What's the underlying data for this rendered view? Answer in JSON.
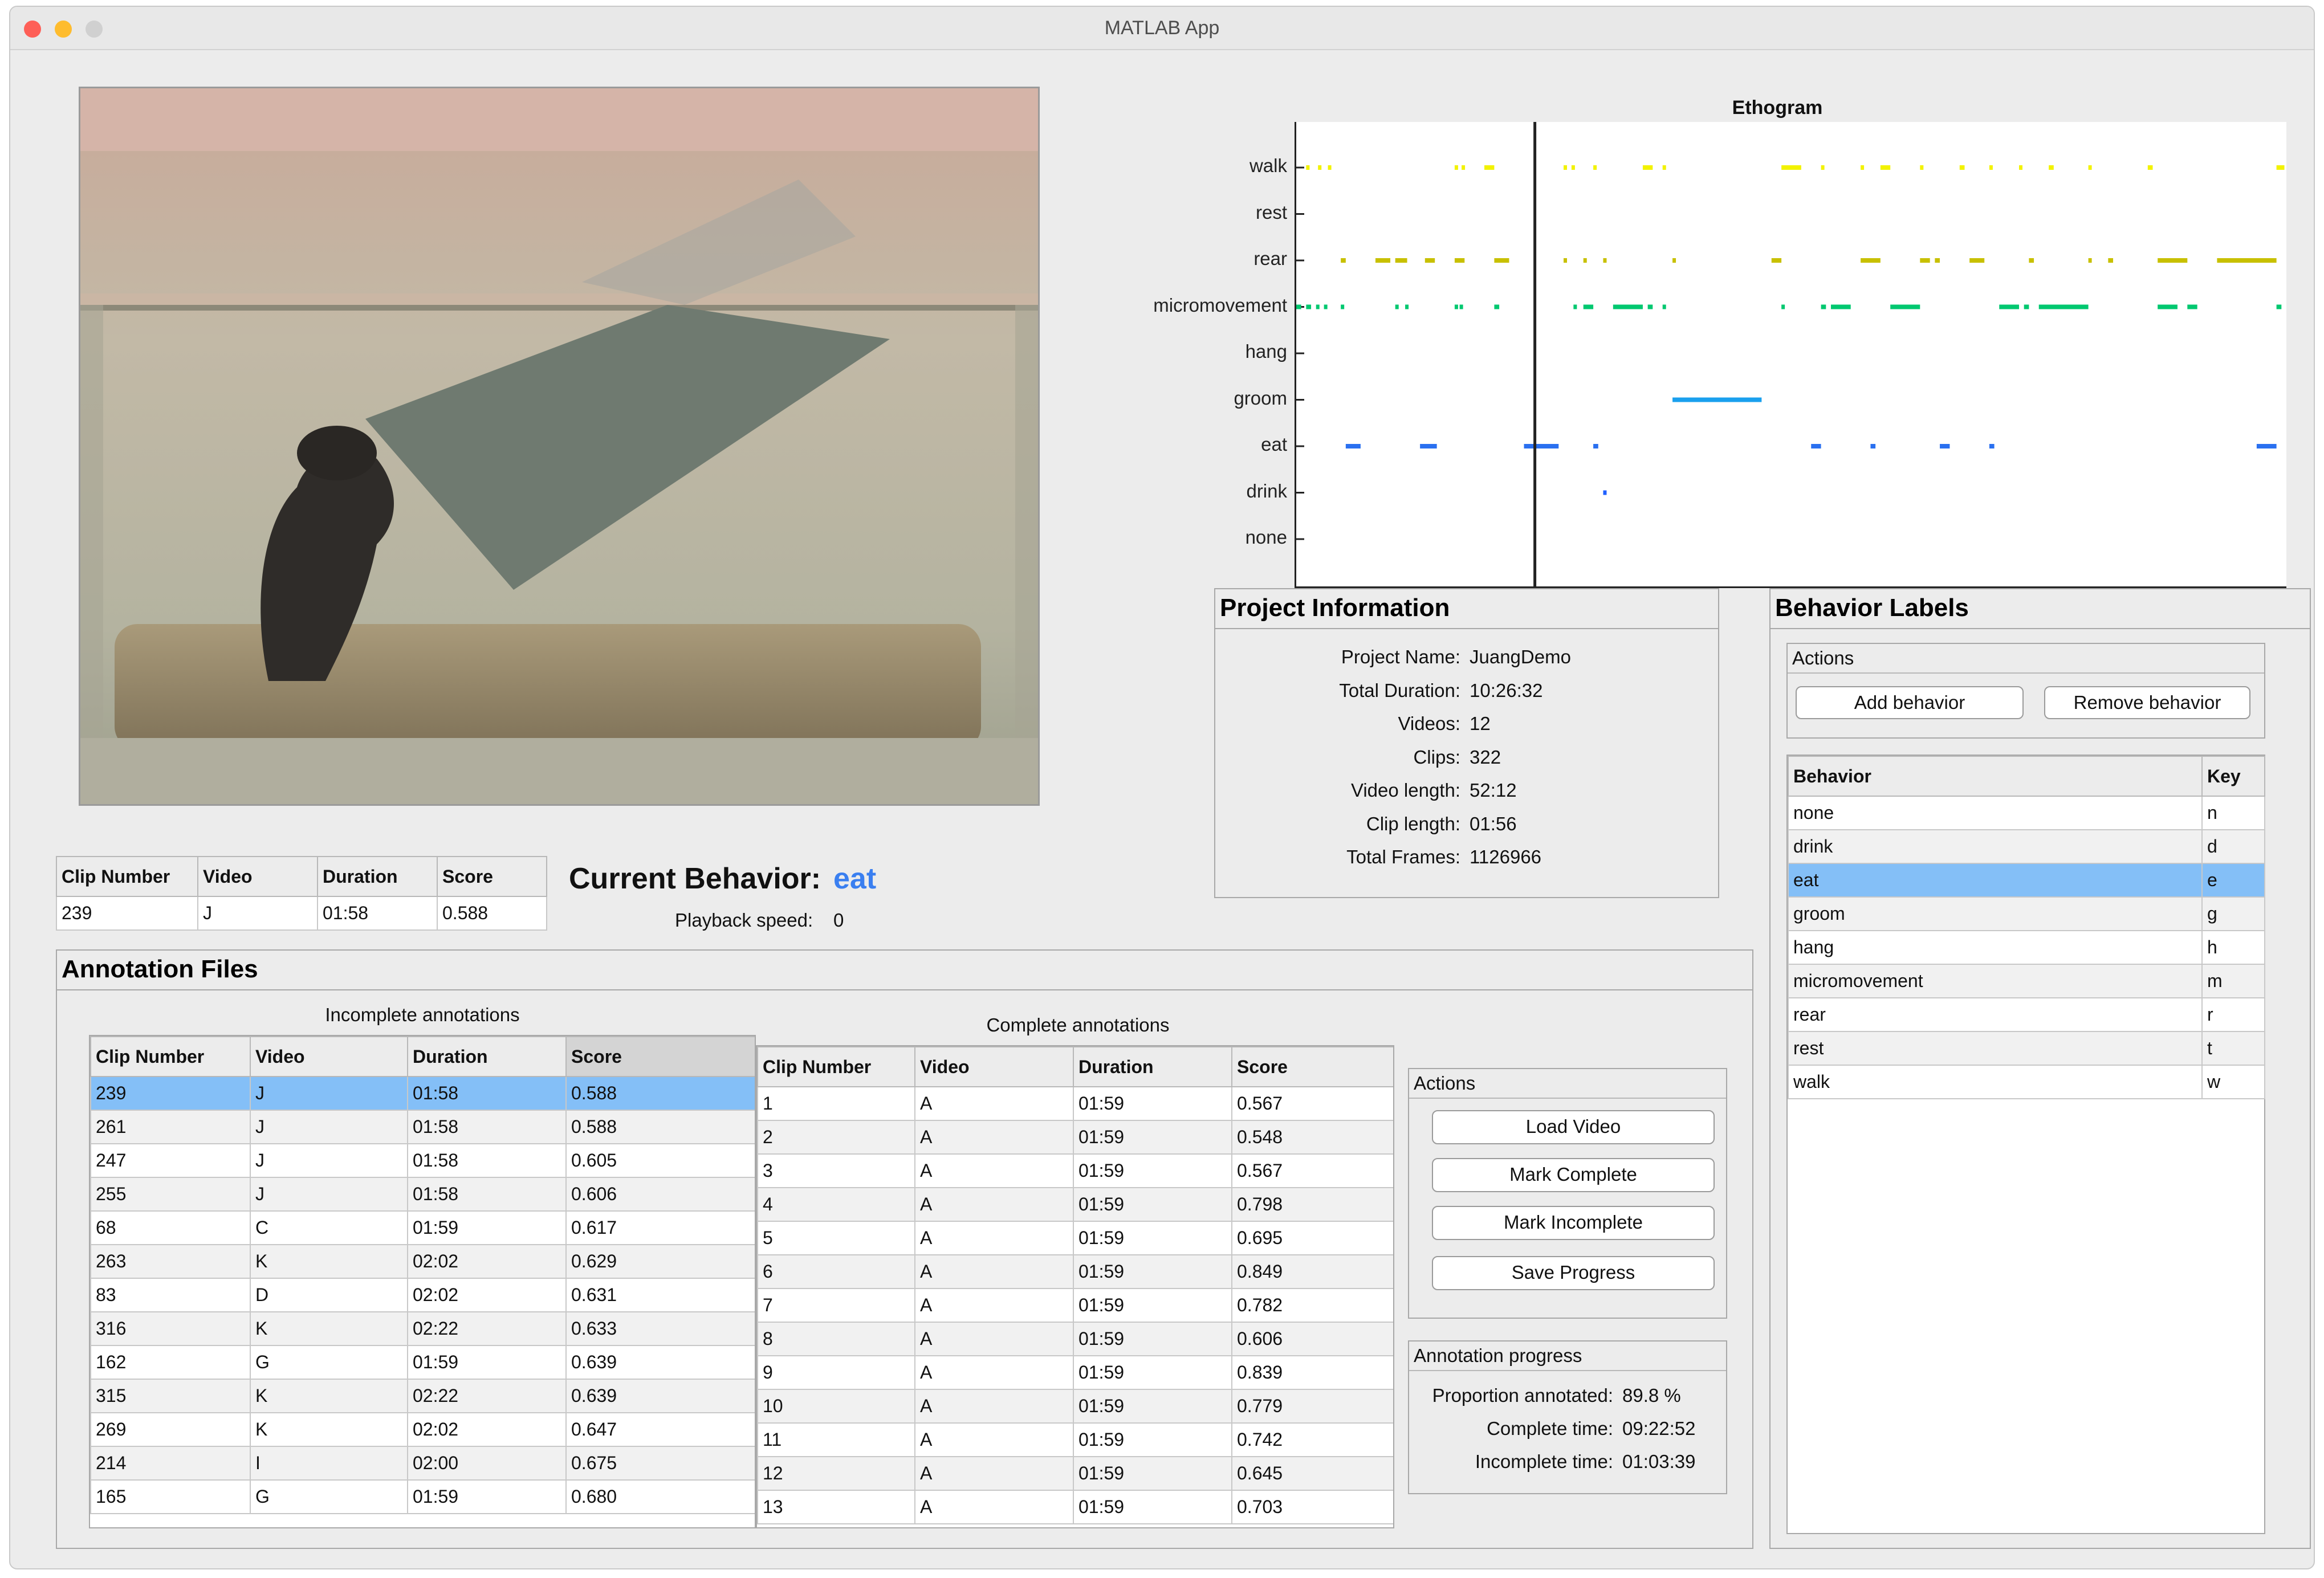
{
  "window": {
    "title": "MATLAB App"
  },
  "colors": {
    "selection": "#84bff7",
    "accent": "#3a7ff0"
  },
  "clip_table": {
    "headers": [
      "Clip Number",
      "Video",
      "Duration",
      "Score"
    ],
    "row": [
      "239",
      "J",
      "01:58",
      "0.588"
    ]
  },
  "current_behavior": {
    "label": "Current Behavior:",
    "value": "eat",
    "playback_label": "Playback speed:",
    "playback_value": "0"
  },
  "ethogram": {
    "title": "Ethogram",
    "behaviors": [
      "walk",
      "rest",
      "rear",
      "micromovement",
      "hang",
      "groom",
      "eat",
      "drink",
      "none"
    ]
  },
  "chart_data": {
    "type": "ethogram",
    "title": "Ethogram",
    "categories": [
      "walk",
      "rest",
      "rear",
      "micromovement",
      "hang",
      "groom",
      "eat",
      "drink",
      "none"
    ],
    "x_range": [
      0,
      1
    ],
    "cursor_x": 0.241,
    "series": [
      {
        "category": "walk",
        "color": "#f2f200",
        "segments": [
          [
            0.01,
            0.012
          ],
          [
            0.022,
            0.024
          ],
          [
            0.032,
            0.035
          ],
          [
            0.16,
            0.163
          ],
          [
            0.167,
            0.17
          ],
          [
            0.19,
            0.2
          ],
          [
            0.27,
            0.272
          ],
          [
            0.278,
            0.28
          ],
          [
            0.3,
            0.302
          ],
          [
            0.35,
            0.36
          ],
          [
            0.37,
            0.37
          ],
          [
            0.49,
            0.51
          ],
          [
            0.53,
            0.532
          ],
          [
            0.57,
            0.572
          ],
          [
            0.59,
            0.6
          ],
          [
            0.63,
            0.632
          ],
          [
            0.67,
            0.675
          ],
          [
            0.7,
            0.702
          ],
          [
            0.73,
            0.732
          ],
          [
            0.76,
            0.765
          ],
          [
            0.8,
            0.802
          ],
          [
            0.86,
            0.865
          ],
          [
            0.99,
            0.998
          ]
        ]
      },
      {
        "category": "rear",
        "color": "#c8c000",
        "segments": [
          [
            0.045,
            0.05
          ],
          [
            0.08,
            0.095
          ],
          [
            0.1,
            0.112
          ],
          [
            0.13,
            0.14
          ],
          [
            0.16,
            0.17
          ],
          [
            0.2,
            0.215
          ],
          [
            0.27,
            0.272
          ],
          [
            0.29,
            0.292
          ],
          [
            0.31,
            0.312
          ],
          [
            0.38,
            0.382
          ],
          [
            0.48,
            0.49
          ],
          [
            0.57,
            0.59
          ],
          [
            0.63,
            0.64
          ],
          [
            0.645,
            0.65
          ],
          [
            0.68,
            0.695
          ],
          [
            0.74,
            0.745
          ],
          [
            0.8,
            0.802
          ],
          [
            0.82,
            0.825
          ],
          [
            0.87,
            0.9
          ],
          [
            0.93,
            0.99
          ]
        ]
      },
      {
        "category": "micromovement",
        "color": "#00c870",
        "segments": [
          [
            0.0,
            0.005
          ],
          [
            0.01,
            0.015
          ],
          [
            0.02,
            0.022
          ],
          [
            0.028,
            0.03
          ],
          [
            0.045,
            0.048
          ],
          [
            0.1,
            0.102
          ],
          [
            0.11,
            0.112
          ],
          [
            0.16,
            0.162
          ],
          [
            0.165,
            0.167
          ],
          [
            0.2,
            0.205
          ],
          [
            0.28,
            0.282
          ],
          [
            0.29,
            0.3
          ],
          [
            0.32,
            0.35
          ],
          [
            0.355,
            0.36
          ],
          [
            0.37,
            0.372
          ],
          [
            0.49,
            0.492
          ],
          [
            0.53,
            0.535
          ],
          [
            0.54,
            0.56
          ],
          [
            0.6,
            0.63
          ],
          [
            0.71,
            0.73
          ],
          [
            0.735,
            0.74
          ],
          [
            0.75,
            0.8
          ],
          [
            0.87,
            0.89
          ],
          [
            0.9,
            0.91
          ],
          [
            0.99,
            0.995
          ]
        ]
      },
      {
        "category": "groom",
        "color": "#1aa0ee",
        "segments": [
          [
            0.38,
            0.47
          ]
        ]
      },
      {
        "category": "eat",
        "color": "#2a70f0",
        "segments": [
          [
            0.05,
            0.065
          ],
          [
            0.125,
            0.142
          ],
          [
            0.23,
            0.265
          ],
          [
            0.3,
            0.305
          ],
          [
            0.52,
            0.53
          ],
          [
            0.58,
            0.585
          ],
          [
            0.65,
            0.66
          ],
          [
            0.7,
            0.705
          ],
          [
            0.97,
            0.99
          ]
        ]
      },
      {
        "category": "drink",
        "color": "#2060ff",
        "segments": [
          [
            0.31,
            0.312
          ]
        ]
      }
    ]
  },
  "project_info": {
    "title": "Project Information",
    "fields": [
      {
        "label": "Project Name:",
        "value": "JuangDemo"
      },
      {
        "label": "Total Duration:",
        "value": "10:26:32"
      },
      {
        "label": "Videos:",
        "value": "12"
      },
      {
        "label": "Clips:",
        "value": "322"
      },
      {
        "label": "Video length:",
        "value": "52:12"
      },
      {
        "label": "Clip length:",
        "value": "01:56"
      },
      {
        "label": "Total Frames:",
        "value": "1126966"
      }
    ]
  },
  "behavior_labels": {
    "title": "Behavior Labels",
    "actions_title": "Actions",
    "add_label": "Add behavior",
    "remove_label": "Remove behavior",
    "headers": [
      "Behavior",
      "Key"
    ],
    "rows": [
      [
        "none",
        "n"
      ],
      [
        "drink",
        "d"
      ],
      [
        "eat",
        "e"
      ],
      [
        "groom",
        "g"
      ],
      [
        "hang",
        "h"
      ],
      [
        "micromovement",
        "m"
      ],
      [
        "rear",
        "r"
      ],
      [
        "rest",
        "t"
      ],
      [
        "walk",
        "w"
      ]
    ],
    "selected_index": 2
  },
  "annotation_files": {
    "title": "Annotation Files",
    "incomplete_title": "Incomplete annotations",
    "complete_title": "Complete annotations",
    "headers": [
      "Clip Number",
      "Video",
      "Duration",
      "Score"
    ],
    "incomplete_rows": [
      [
        "239",
        "J",
        "01:58",
        "0.588"
      ],
      [
        "261",
        "J",
        "01:58",
        "0.588"
      ],
      [
        "247",
        "J",
        "01:58",
        "0.605"
      ],
      [
        "255",
        "J",
        "01:58",
        "0.606"
      ],
      [
        "68",
        "C",
        "01:59",
        "0.617"
      ],
      [
        "263",
        "K",
        "02:02",
        "0.629"
      ],
      [
        "83",
        "D",
        "02:02",
        "0.631"
      ],
      [
        "316",
        "K",
        "02:22",
        "0.633"
      ],
      [
        "162",
        "G",
        "01:59",
        "0.639"
      ],
      [
        "315",
        "K",
        "02:22",
        "0.639"
      ],
      [
        "269",
        "K",
        "02:02",
        "0.647"
      ],
      [
        "214",
        "I",
        "02:00",
        "0.675"
      ],
      [
        "165",
        "G",
        "01:59",
        "0.680"
      ]
    ],
    "complete_rows": [
      [
        "1",
        "A",
        "01:59",
        "0.567"
      ],
      [
        "2",
        "A",
        "01:59",
        "0.548"
      ],
      [
        "3",
        "A",
        "01:59",
        "0.567"
      ],
      [
        "4",
        "A",
        "01:59",
        "0.798"
      ],
      [
        "5",
        "A",
        "01:59",
        "0.695"
      ],
      [
        "6",
        "A",
        "01:59",
        "0.849"
      ],
      [
        "7",
        "A",
        "01:59",
        "0.782"
      ],
      [
        "8",
        "A",
        "01:59",
        "0.606"
      ],
      [
        "9",
        "A",
        "01:59",
        "0.839"
      ],
      [
        "10",
        "A",
        "01:59",
        "0.779"
      ],
      [
        "11",
        "A",
        "01:59",
        "0.742"
      ],
      [
        "12",
        "A",
        "01:59",
        "0.645"
      ],
      [
        "13",
        "A",
        "01:59",
        "0.703"
      ]
    ],
    "actions_title": "Actions",
    "buttons": [
      "Load Video",
      "Mark Complete",
      "Mark Incomplete",
      "Save Progress"
    ],
    "progress_title": "Annotation progress",
    "progress_fields": [
      {
        "label": "Proportion annotated:",
        "value": "89.8 %"
      },
      {
        "label": "Complete time:",
        "value": "09:22:52"
      },
      {
        "label": "Incomplete time:",
        "value": "01:03:39"
      }
    ]
  }
}
